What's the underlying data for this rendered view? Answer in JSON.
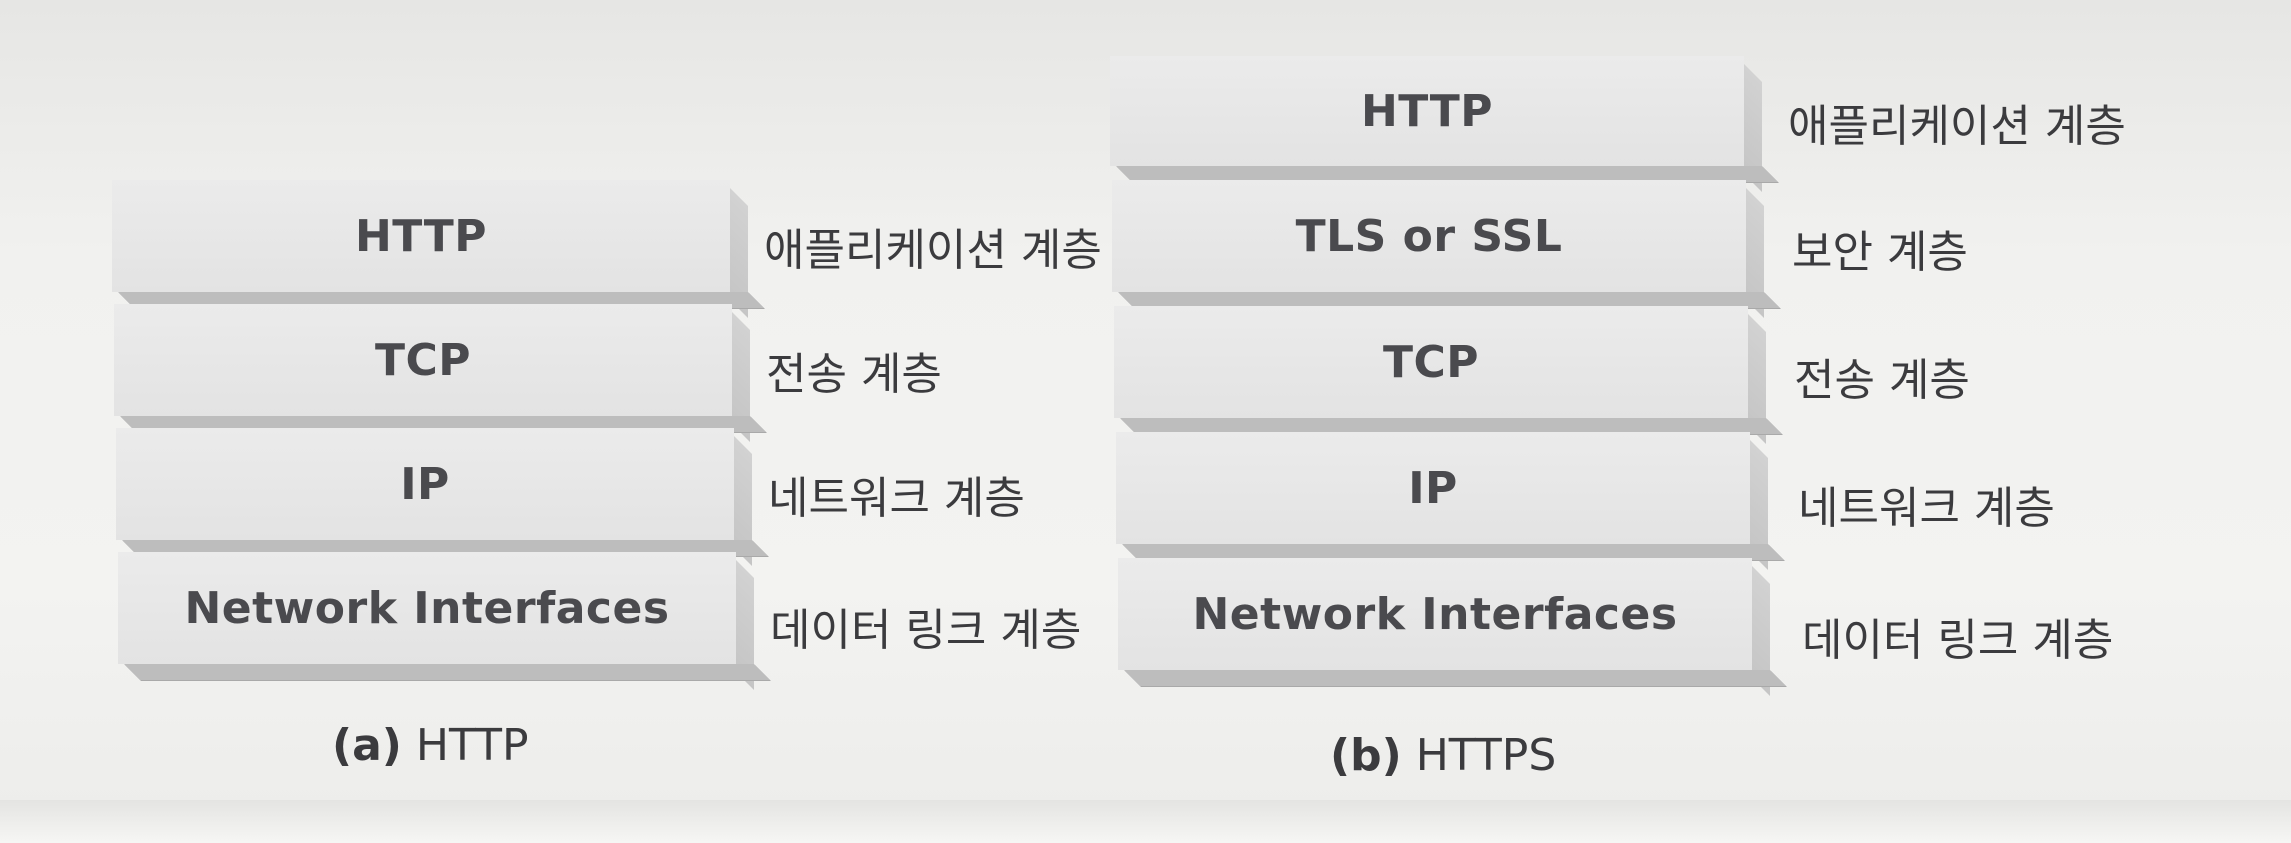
{
  "diagrams": [
    {
      "caption_mark": "(a)",
      "caption_text": "HTTP",
      "layers": [
        {
          "name": "HTTP",
          "layer_label": "애플리케이션 계층"
        },
        {
          "name": "TCP",
          "layer_label": "전송 계층"
        },
        {
          "name": "IP",
          "layer_label": "네트워크 계층"
        },
        {
          "name": "Network Interfaces",
          "layer_label": "데이터 링크 계층"
        }
      ]
    },
    {
      "caption_mark": "(b)",
      "caption_text": "HTTPS",
      "layers": [
        {
          "name": "HTTP",
          "layer_label": "애플리케이션 계층"
        },
        {
          "name": "TLS or SSL",
          "layer_label": "보안 계층"
        },
        {
          "name": "TCP",
          "layer_label": "전송 계층"
        },
        {
          "name": "IP",
          "layer_label": "네트워크 계층"
        },
        {
          "name": "Network Interfaces",
          "layer_label": "데이터 링크 계층"
        }
      ]
    }
  ]
}
